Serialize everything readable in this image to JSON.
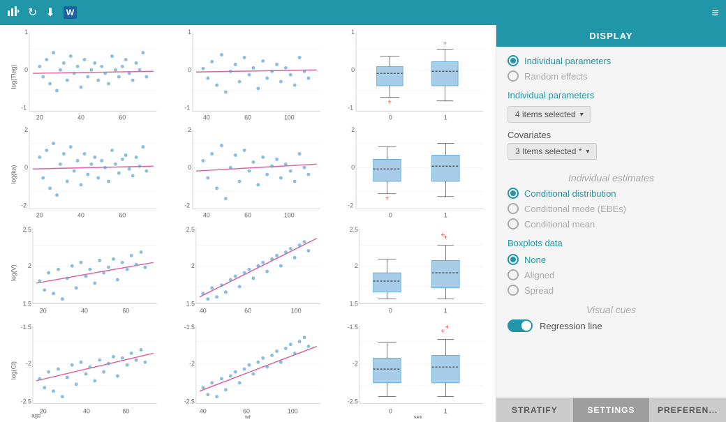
{
  "header": {
    "title": "DISPLAY",
    "icons": [
      "chart-icon",
      "refresh-icon",
      "download-icon",
      "word-icon",
      "menu-icon"
    ]
  },
  "panel": {
    "display_label": "DISPLAY",
    "individual_parameters_label": "Individual parameters",
    "random_effects_label": "Random effects",
    "individual_params_section": "Individual parameters",
    "four_items_selected": "4 items selected",
    "covariates_label": "Covariates",
    "three_items_selected": "3 Items selected *",
    "individual_estimates_label": "Individual estimates",
    "conditional_distribution_label": "Conditional distribution",
    "conditional_mode_label": "Conditional mode (EBEs)",
    "conditional_mean_label": "Conditional mean",
    "boxplots_data_label": "Boxplots data",
    "none_label": "None",
    "aligned_label": "Aligned",
    "spread_label": "Spread",
    "visual_cues_label": "Visual cues",
    "regression_line_label": "Regression line",
    "stratify_btn": "STRATIFY",
    "settings_btn": "SETTINGS",
    "preferences_btn": "PREFEREN..."
  },
  "plots": {
    "rows": [
      {
        "yLabel": "log(Tlag)",
        "cols": [
          "age",
          "wt",
          "sex"
        ]
      },
      {
        "yLabel": "log(ka)",
        "cols": [
          "age",
          "wt",
          "sex"
        ]
      },
      {
        "yLabel": "log(V)",
        "cols": [
          "age",
          "wt",
          "sex"
        ]
      },
      {
        "yLabel": "log(Cl)",
        "cols": [
          "age",
          "wt",
          "sex"
        ]
      }
    ],
    "xLabels": [
      "age",
      "wt",
      "sex"
    ]
  }
}
